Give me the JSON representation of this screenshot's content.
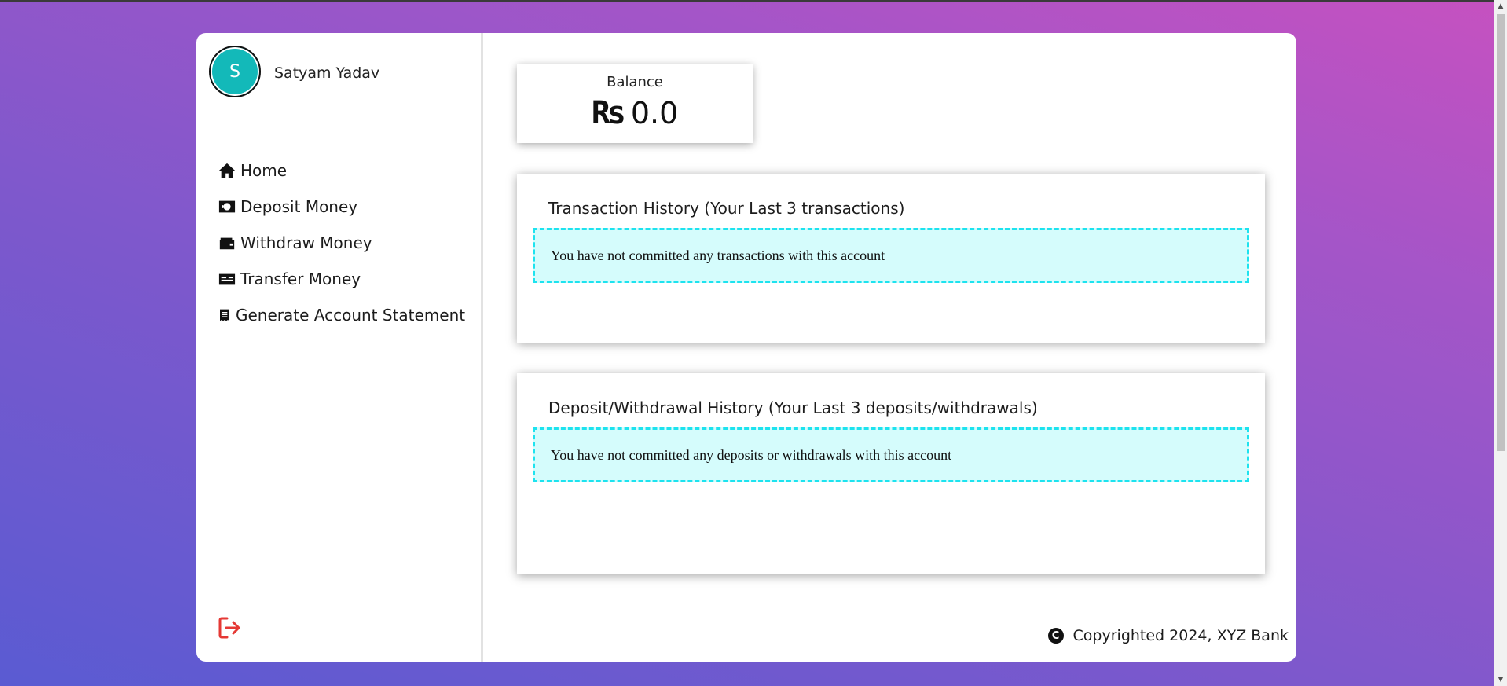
{
  "user": {
    "initial": "S",
    "name": "Satyam Yadav"
  },
  "nav": {
    "items": [
      {
        "label": "Home",
        "icon": "home-icon"
      },
      {
        "label": "Deposit Money",
        "icon": "money-bill-icon"
      },
      {
        "label": "Withdraw Money",
        "icon": "wallet-icon"
      },
      {
        "label": "Transfer Money",
        "icon": "id-card-icon"
      },
      {
        "label": "Generate Account Statement",
        "icon": "receipt-icon"
      }
    ],
    "logout_icon": "logout-icon"
  },
  "balance": {
    "title": "Balance",
    "currency": "Rs",
    "amount": "0.0"
  },
  "transactions": {
    "title": "Transaction History (Your Last 3 transactions)",
    "empty_message": "You have not committed any transactions with this account"
  },
  "deposits": {
    "title": "Deposit/Withdrawal History (Your Last 3 deposits/withdrawals)",
    "empty_message": "You have not committed any deposits or withdrawals with this account"
  },
  "footer": {
    "text": "Copyrighted 2024, XYZ Bank",
    "icon": "copyright-icon"
  },
  "colors": {
    "accent": "#13b9b9",
    "logout": "#e53935",
    "notice_bg": "#d5fcfc",
    "notice_border": "#1de3ef"
  }
}
